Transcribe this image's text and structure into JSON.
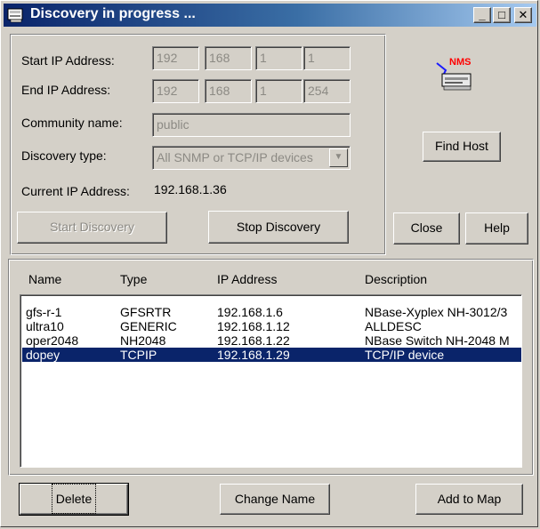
{
  "window": {
    "title": "Discovery in progress ...",
    "minimize": "_",
    "maximize": "□",
    "close": "✕"
  },
  "form": {
    "start_ip_label": "Start IP Address:",
    "start_ip": [
      "192",
      "168",
      "1",
      "1"
    ],
    "end_ip_label": "End IP Address:",
    "end_ip": [
      "192",
      "168",
      "1",
      "254"
    ],
    "community_label": "Community name:",
    "community_value": "public",
    "discovery_type_label": "Discovery type:",
    "discovery_type_value": "All SNMP or TCP/IP devices",
    "current_ip_label": "Current IP Address:",
    "current_ip_value": "192.168.1.36"
  },
  "buttons": {
    "start_discovery": "Start Discovery",
    "stop_discovery": "Stop Discovery",
    "find_host": "Find Host",
    "close": "Close",
    "help": "Help",
    "delete": "Delete",
    "change_name": "Change Name",
    "add_to_map": "Add to Map"
  },
  "logo_text": "NMS",
  "table": {
    "columns": [
      "Name",
      "Type",
      "IP Address",
      "Description"
    ],
    "rows": [
      {
        "name": "gfs-r-1",
        "type": "GFSRTR",
        "ip": "192.168.1.6",
        "description": "NBase-Xyplex NH-3012/3"
      },
      {
        "name": "ultra10",
        "type": "GENERIC",
        "ip": "192.168.1.12",
        "description": "ALLDESC"
      },
      {
        "name": "oper2048",
        "type": "NH2048",
        "ip": "192.168.1.22",
        "description": "NBase Switch NH-2048 M"
      },
      {
        "name": "dopey",
        "type": "TCPIP",
        "ip": "192.168.1.29",
        "description": "TCP/IP device"
      }
    ],
    "selected_row": "dopey"
  },
  "colors": {
    "title_gradient_start": "#0a246a",
    "selection": "#0a246a",
    "face": "#d4d0c8",
    "disabled_text": "#8c8a84"
  }
}
